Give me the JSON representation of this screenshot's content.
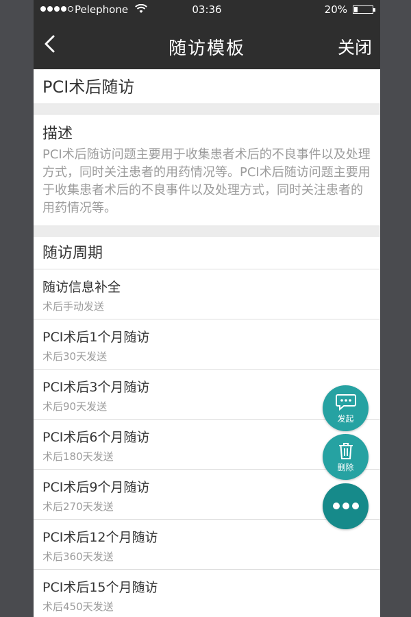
{
  "status_bar": {
    "carrier": "Pelephone",
    "time": "03:36",
    "battery": "20%",
    "battery_level": 0.2
  },
  "nav": {
    "title": "随访模板",
    "close_label": "关闭"
  },
  "template": {
    "name": "PCI术后随访",
    "description_label": "描述",
    "description": "PCI术后随访问题主要用于收集患者术后的不良事件以及处理方式，同时关注患者的用药情况等。PCI术后随访问题主要用于收集患者术后的不良事件以及处理方式，同时关注患者的用药情况等。"
  },
  "periods": {
    "header": "随访周期",
    "items": [
      {
        "name": "随访信息补全",
        "sub": "术后手动发送"
      },
      {
        "name": "PCI术后1个月随访",
        "sub": "术后30天发送"
      },
      {
        "name": "PCI术后3个月随访",
        "sub": "术后90天发送"
      },
      {
        "name": "PCI术后6个月随访",
        "sub": "术后180天发送"
      },
      {
        "name": "PCI术后9个月随访",
        "sub": "术后270天发送"
      },
      {
        "name": "PCI术后12个月随访",
        "sub": "术后360天发送"
      },
      {
        "name": "PCI术后15个月随访",
        "sub": "术后450天发送"
      }
    ]
  },
  "fabs": {
    "launch_label": "发起",
    "delete_label": "删除",
    "launch_icon": "chat-bubble-icon",
    "delete_icon": "trash-icon",
    "more_icon": "more-dots-icon"
  },
  "colors": {
    "header_bg": "#2e2e2e",
    "fab_teal": "#26a2a2",
    "fab_dark_teal": "#168a8a"
  }
}
